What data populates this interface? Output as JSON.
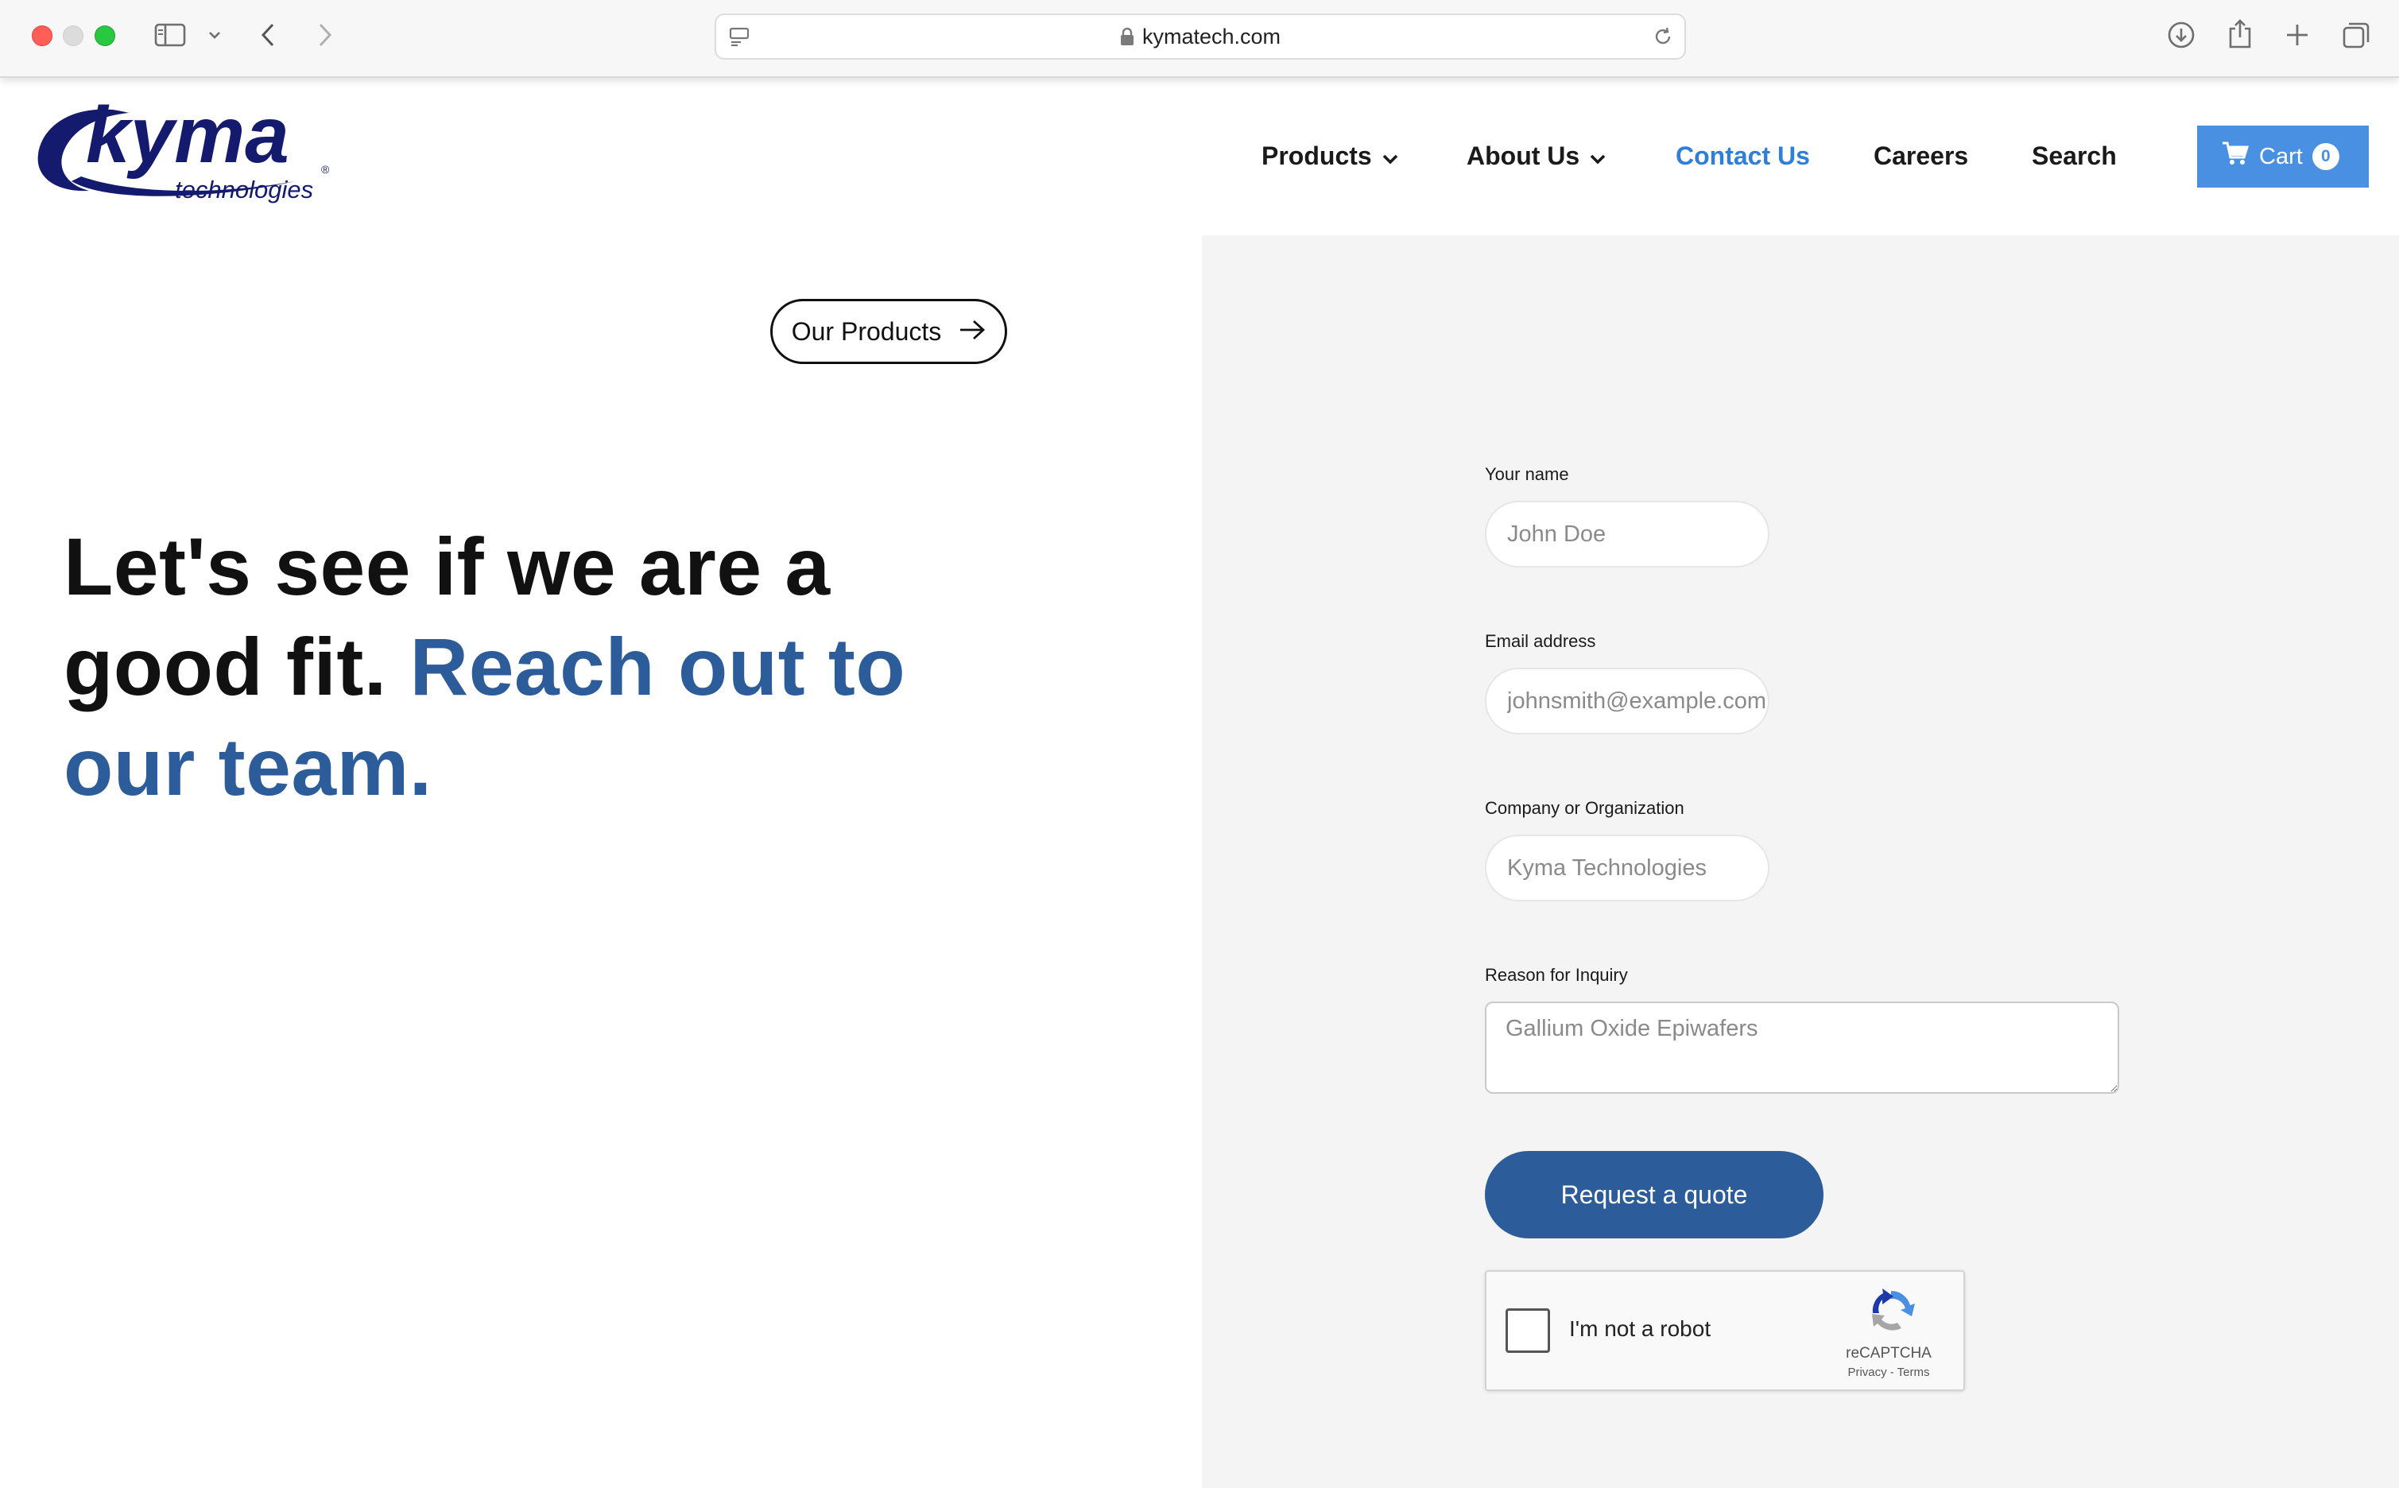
{
  "browser": {
    "url": "kymatech.com"
  },
  "header": {
    "logo_text": "kyma",
    "logo_subtext": "technologies",
    "logo_mark": "®",
    "nav": {
      "products": "Products",
      "about": "About Us",
      "contact": "Contact Us",
      "careers": "Careers",
      "search": "Search"
    },
    "cart": {
      "label": "Cart",
      "count": "0"
    },
    "colors": {
      "brand_navy": "#141a6e",
      "active_link": "#2f7fd8",
      "cart_bg": "#4a90e2"
    }
  },
  "hero": {
    "pill_label": "Our Products",
    "headline_plain": "Let's see if we are a good fit.",
    "headline_accent": "Reach out to our team.",
    "accent_color": "#2c5d9a"
  },
  "form": {
    "name_label": "Your name",
    "name_placeholder": "John Doe",
    "email_label": "Email address",
    "email_placeholder": "johnsmith@example.com",
    "company_label": "Company or Organization",
    "company_placeholder": "Kyma Technologies",
    "reason_label": "Reason for Inquiry",
    "reason_placeholder": "Gallium Oxide Epiwafers",
    "submit_label": "Request a quote"
  },
  "captcha": {
    "label": "I'm not a robot",
    "brand": "reCAPTCHA",
    "links": "Privacy - Terms",
    "checked": false
  }
}
